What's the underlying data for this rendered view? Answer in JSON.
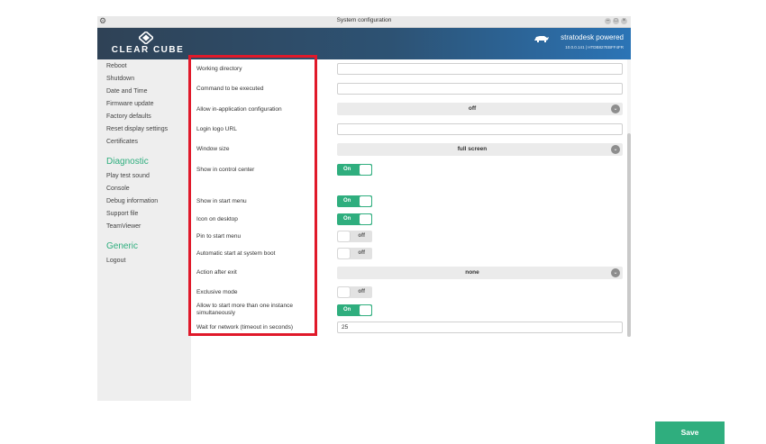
{
  "window": {
    "title": "System configuration"
  },
  "header": {
    "logo_text": "CLEAR CUBE",
    "brand": "stratodesk powered",
    "version_info": "10.0.0.141 | HTDB827EBFF4FR"
  },
  "sidebar": {
    "items_top": [
      "Reboot",
      "Shutdown",
      "Date and Time",
      "Firmware update",
      "Factory defaults",
      "Reset display settings",
      "Certificates"
    ],
    "diagnostic_title": "Diagnostic",
    "diagnostic_items": [
      "Play test sound",
      "Console",
      "Debug information",
      "Support file",
      "TeamViewer"
    ],
    "generic_title": "Generic",
    "generic_items": [
      "Logout"
    ]
  },
  "form": {
    "working_directory": {
      "label": "Working directory",
      "value": ""
    },
    "command": {
      "label": "Command to be executed",
      "value": ""
    },
    "allow_in_app_config": {
      "label": "Allow in-application configuration",
      "value": "off"
    },
    "login_logo_url": {
      "label": "Login logo URL",
      "value": ""
    },
    "window_size": {
      "label": "Window size",
      "value": "full screen"
    },
    "show_in_control_center": {
      "label": "Show in control center",
      "state": "On"
    },
    "show_in_start_menu": {
      "label": "Show in start menu",
      "state": "On"
    },
    "icon_on_desktop": {
      "label": "Icon on desktop",
      "state": "On"
    },
    "pin_to_start_menu": {
      "label": "Pin to start menu",
      "state": "off"
    },
    "auto_start": {
      "label": "Automatic start at system boot",
      "state": "off"
    },
    "action_after_exit": {
      "label": "Action after exit",
      "value": "none"
    },
    "exclusive_mode": {
      "label": "Exclusive mode",
      "state": "off"
    },
    "multi_instance": {
      "label": "Allow to start more than one instance simultaneously",
      "state": "On"
    },
    "wait_for_network": {
      "label": "Wait for network (timeout in seconds)",
      "value": "25"
    }
  },
  "actions": {
    "save_label": "Save"
  },
  "colors": {
    "accent_green": "#2fae7e",
    "header_dark": "#2f4256",
    "header_blue": "#2b74b6",
    "highlight_red": "#e0192a"
  },
  "icons": [
    "gear-icon",
    "clearcube-logo-icon",
    "rhino-icon",
    "chevron-down-icon",
    "window-minimize-icon",
    "window-maximize-icon",
    "window-close-icon"
  ]
}
